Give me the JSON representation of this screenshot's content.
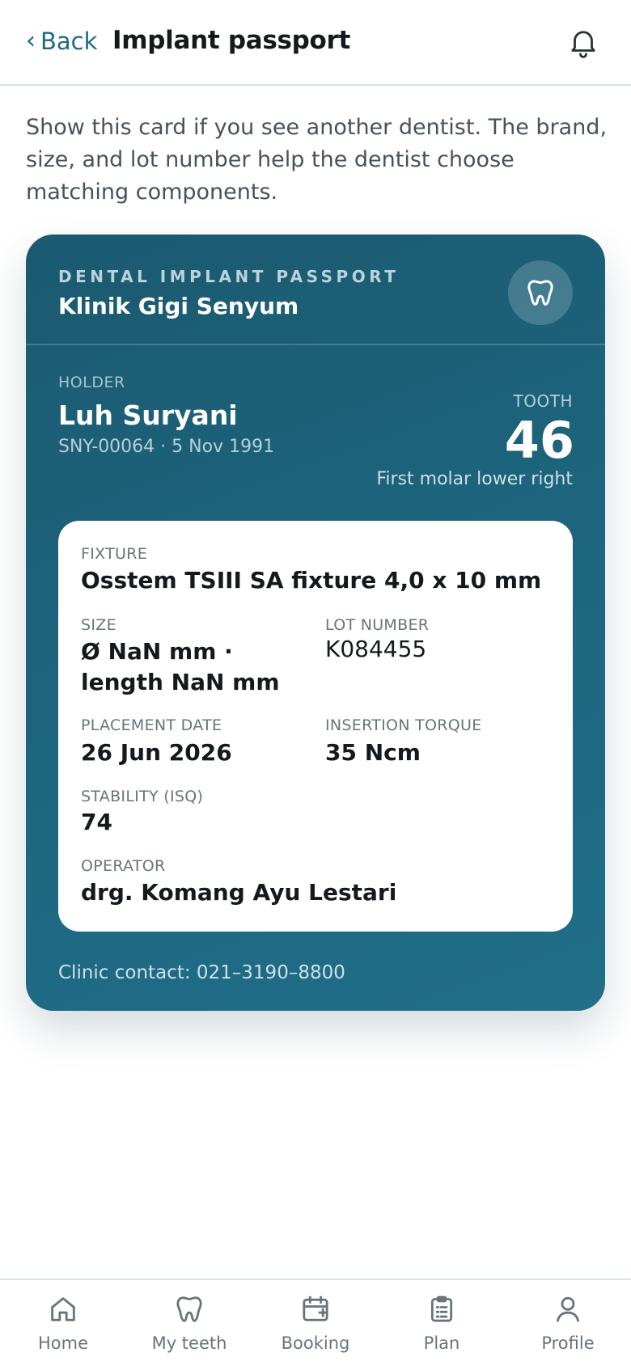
{
  "header": {
    "back_label": "Back",
    "title": "Implant passport",
    "bell_icon": "bell-icon"
  },
  "intro": "Show this card if you see another dentist. The brand, size, and lot number help the dentist choose matching components.",
  "card": {
    "eyebrow": "DENTAL IMPLANT PASSPORT",
    "clinic": "Klinik Gigi Senyum",
    "badge_icon": "tooth-icon",
    "holder_label": "HOLDER",
    "holder_name": "Luh Suryani",
    "holder_meta": "SNY-00064 · 5 Nov 1991",
    "tooth_label": "TOOTH",
    "tooth_number": "46",
    "tooth_desc": "First molar lower right",
    "details": {
      "fixture_label": "FIXTURE",
      "fixture_value": "Osstem TSIII SA fixture 4,0 x 10 mm",
      "size_label": "SIZE",
      "size_value": "Ø NaN mm · length NaN mm",
      "lot_label": "LOT NUMBER",
      "lot_value": "K084455",
      "placement_label": "PLACEMENT DATE",
      "placement_value": "26 Jun 2026",
      "torque_label": "INSERTION TORQUE",
      "torque_value": "35 Ncm",
      "isq_label": "STABILITY (ISQ)",
      "isq_value": "74",
      "operator_label": "OPERATOR",
      "operator_value": "drg. Komang Ayu Lestari"
    },
    "contact": "Clinic contact: 021–3190–8800"
  },
  "tabs": [
    {
      "label": "Home",
      "icon": "home-icon"
    },
    {
      "label": "My teeth",
      "icon": "tooth-icon"
    },
    {
      "label": "Booking",
      "icon": "calendar-plus-icon"
    },
    {
      "label": "Plan",
      "icon": "clipboard-icon"
    },
    {
      "label": "Profile",
      "icon": "user-icon"
    }
  ],
  "colors": {
    "accent": "#1e6a82",
    "card_gradient_start": "#1b5a70",
    "card_gradient_end": "#206e89"
  }
}
